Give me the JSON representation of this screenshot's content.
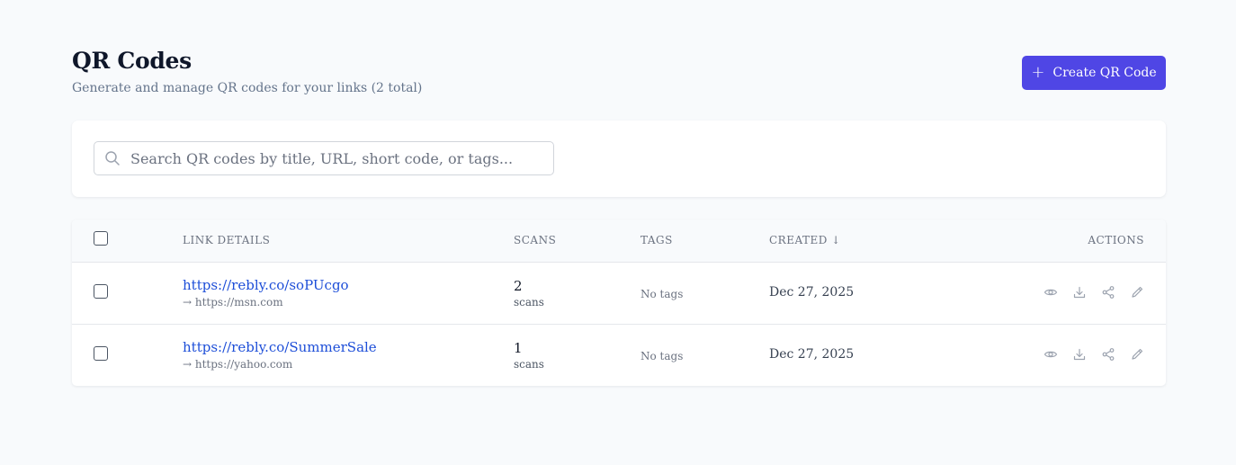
{
  "header": {
    "title": "QR Codes",
    "subtitle": "Generate and manage QR codes for your links (2 total)",
    "create_button": {
      "label": "Create QR Code",
      "icon": "plus-icon",
      "color": "#4f46e5"
    }
  },
  "search": {
    "placeholder": "Search QR codes by title, URL, short code, or tags...",
    "value": "",
    "icon": "search-icon"
  },
  "table": {
    "columns": {
      "link_details": "LINK DETAILS",
      "scans": "SCANS",
      "tags": "TAGS",
      "created": "CREATED ↓",
      "actions": "ACTIONS"
    },
    "rows": [
      {
        "short_url": "https://rebly.co/soPUcgo",
        "destination": "→ https://msn.com",
        "scans": "2",
        "scans_unit": "scans",
        "tags": "No tags",
        "created": "Dec 27, 2025",
        "actions": [
          "eye-icon",
          "download-icon",
          "share-icon",
          "edit-icon"
        ]
      },
      {
        "short_url": "https://rebly.co/SummerSale",
        "destination": "→ https://yahoo.com",
        "scans": "1",
        "scans_unit": "scans",
        "tags": "No tags",
        "created": "Dec 27, 2025",
        "actions": [
          "eye-icon",
          "download-icon",
          "share-icon",
          "edit-icon"
        ]
      }
    ]
  },
  "colors": {
    "accent": "#4f46e5",
    "link": "#1d4ed8",
    "background": "#f8fafc"
  }
}
